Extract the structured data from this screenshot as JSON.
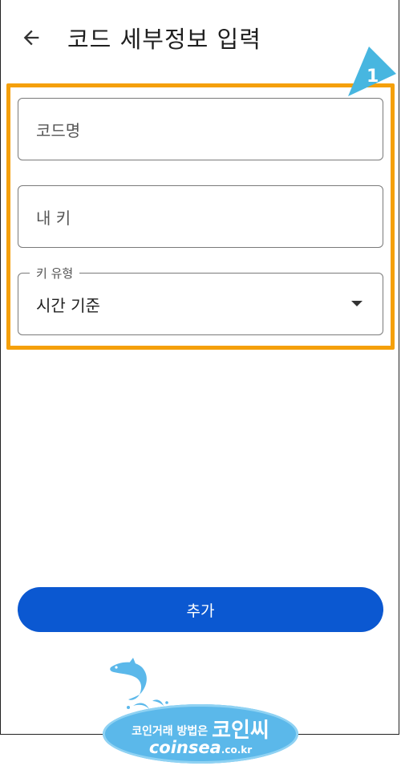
{
  "header": {
    "title": "코드 세부정보 입력",
    "back_icon": "arrow-left-icon"
  },
  "annotation": {
    "step_number": "1",
    "highlight_color": "#f5a00a"
  },
  "form": {
    "code_name": {
      "placeholder": "코드명"
    },
    "my_key": {
      "placeholder": "내 키"
    },
    "key_type": {
      "label": "키 유형",
      "selected": "시간 기준"
    }
  },
  "actions": {
    "add_label": "추가",
    "add_color": "#0b58d1"
  },
  "watermark": {
    "line1_prefix": "코인거래 방법은",
    "line1_brand": "코인씨",
    "line2_site": "coinsea",
    "line2_tld": ".co.kr",
    "badge_color": "#5bb8ea"
  }
}
